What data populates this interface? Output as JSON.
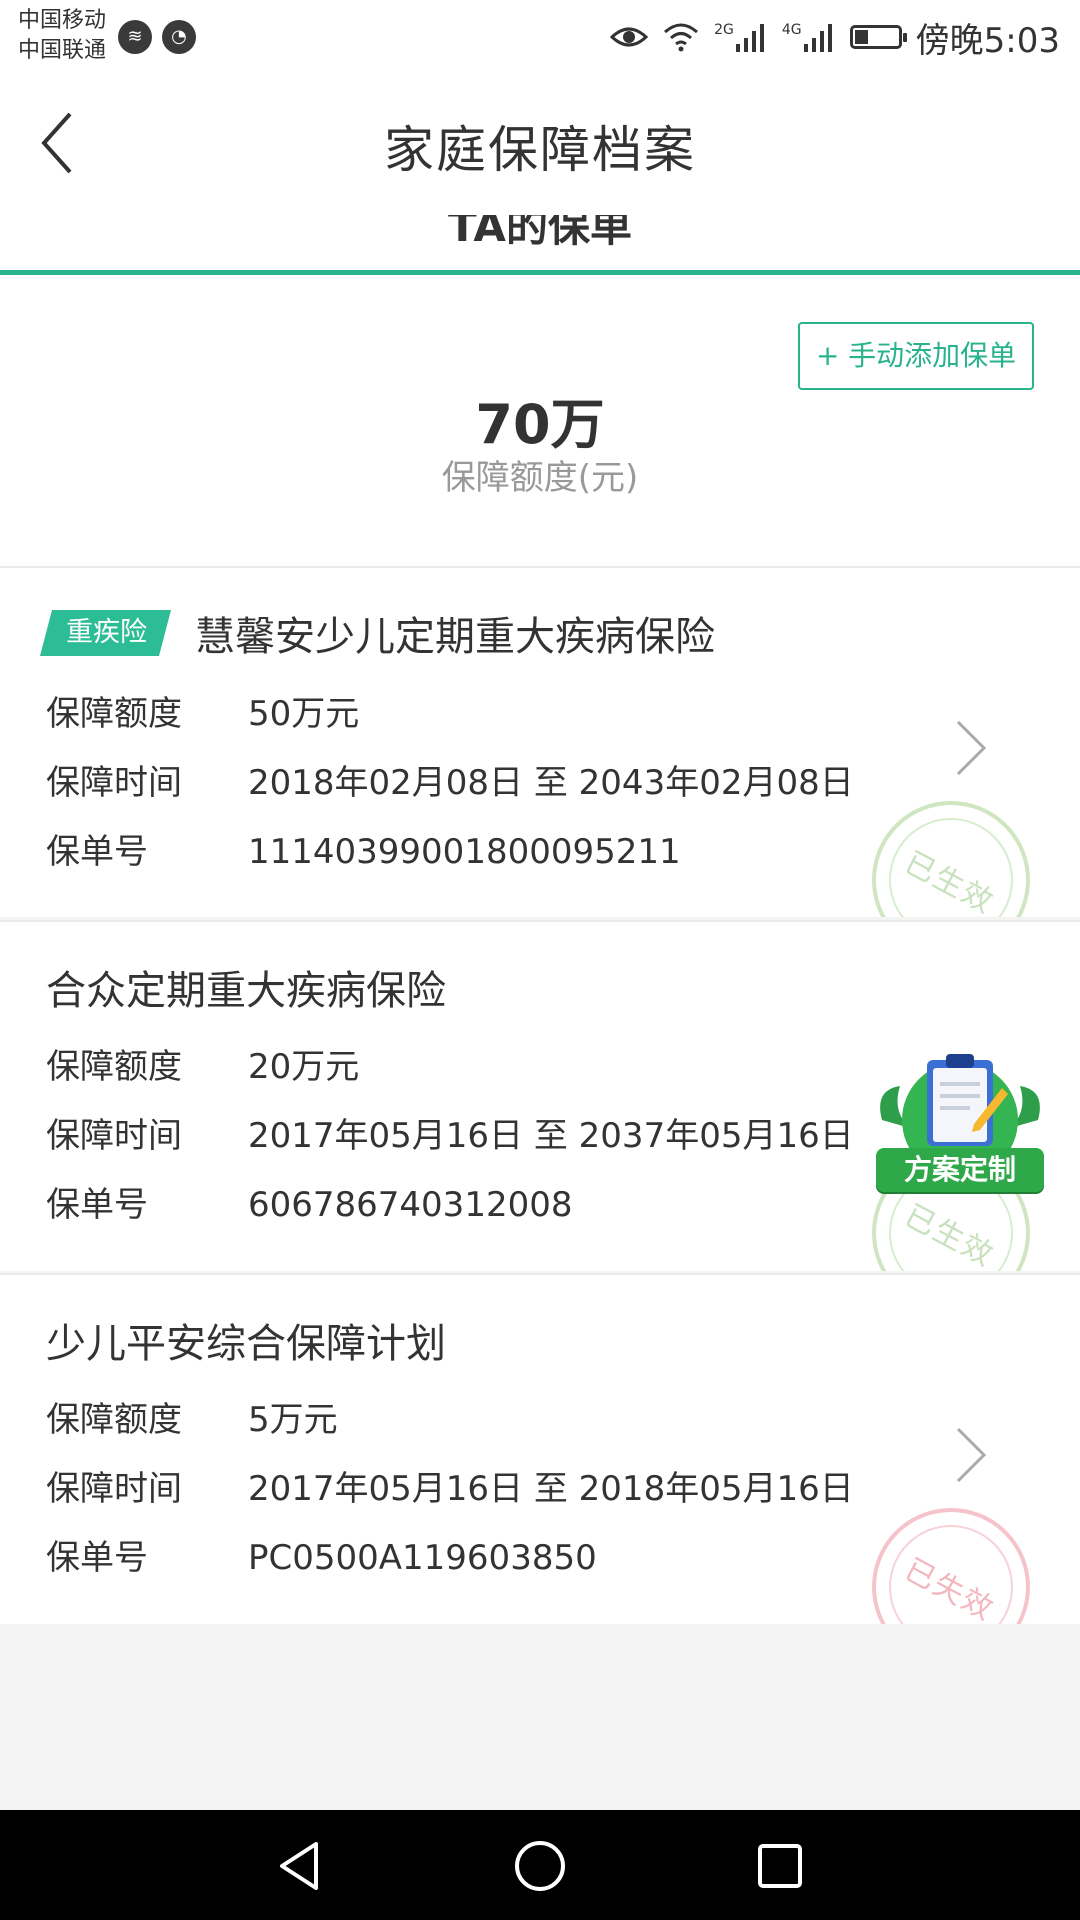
{
  "status_bar": {
    "carrier_1": "中国移动",
    "carrier_2": "中国联通",
    "network_1": "2G",
    "network_2": "4G",
    "time": "傍晚5:03",
    "battery_level": 0.3
  },
  "nav": {
    "title": "家庭保障档案",
    "peek_text": "TA的保单"
  },
  "summary": {
    "add_button": "+ 手动添加保单",
    "total_amount": "70万",
    "total_label": "保障额度(元)"
  },
  "policies": [
    {
      "tag": "重疾险",
      "title": "慧馨安少儿定期重大疾病保险",
      "amount_label": "保障额度",
      "amount": "50万元",
      "period_label": "保障时间",
      "period": "2018年02月08日 至 2043年02月08日",
      "number_label": "保单号",
      "number": "11140399001800095211",
      "stamp": "已生效",
      "status": "valid"
    },
    {
      "title": "合众定期重大疾病保险",
      "amount_label": "保障额度",
      "amount": "20万元",
      "period_label": "保障时间",
      "period": "2017年05月16日 至 2037年05月16日",
      "number_label": "保单号",
      "number": "606786740312008",
      "stamp": "已生效",
      "status": "valid"
    },
    {
      "title": "少儿平安综合保障计划",
      "amount_label": "保障额度",
      "amount": "5万元",
      "period_label": "保障时间",
      "period": "2017年05月16日 至 2018年05月16日",
      "number_label": "保单号",
      "number": "PC0500A119603850",
      "stamp": "已失效",
      "status": "expired"
    }
  ],
  "float_widget": {
    "label": "方案定制"
  },
  "colors": {
    "accent": "#29b38c",
    "valid_stamp": "#cfe6c1",
    "expired_stamp": "#f5c4cb"
  },
  "icons": [
    "back-arrow-icon",
    "chevron-right-icon",
    "clipboard-icon",
    "eye-icon",
    "wifi-icon",
    "signal-icon",
    "battery-icon"
  ]
}
